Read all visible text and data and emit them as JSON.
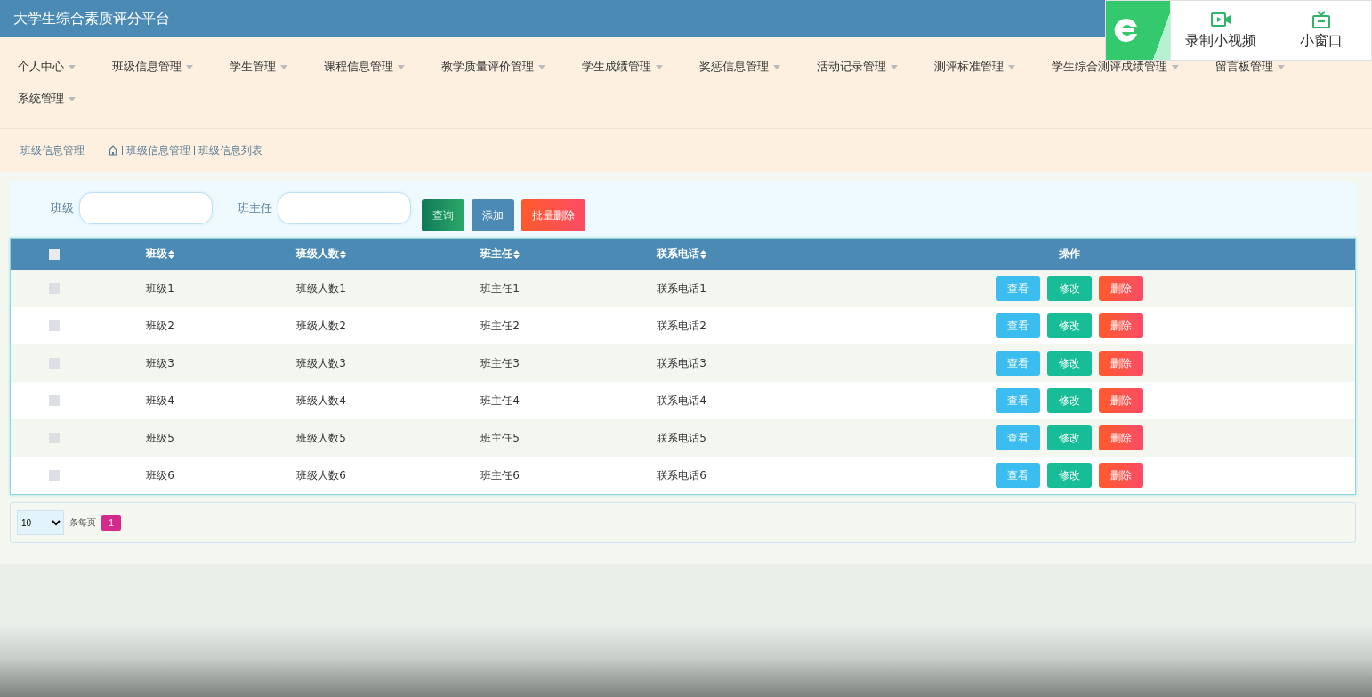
{
  "app_title": "大学生综合素质评分平台",
  "nav": {
    "items": [
      {
        "label": "个人中心"
      },
      {
        "label": "班级信息管理"
      },
      {
        "label": "学生管理"
      },
      {
        "label": "课程信息管理"
      },
      {
        "label": "教学质量评价管理"
      },
      {
        "label": "学生成绩管理"
      },
      {
        "label": "奖惩信息管理"
      },
      {
        "label": "活动记录管理"
      },
      {
        "label": "测评标准管理"
      },
      {
        "label": "学生综合测评成绩管理"
      },
      {
        "label": "留言板管理"
      },
      {
        "label": "系统管理"
      }
    ]
  },
  "breadcrumb": {
    "section": "班级信息管理",
    "path": [
      "班级信息管理",
      "班级信息列表"
    ]
  },
  "search": {
    "fields": [
      {
        "label": "班级"
      },
      {
        "label": "班主任"
      }
    ],
    "buttons": [
      {
        "label": "查询",
        "kind": "search"
      },
      {
        "label": "添加",
        "kind": "add"
      },
      {
        "label": "批量删除",
        "kind": "danger"
      }
    ]
  },
  "table": {
    "header_checked": false,
    "columns": [
      {
        "label": "班级",
        "sortable": true
      },
      {
        "label": "班级人数",
        "sortable": true
      },
      {
        "label": "班主任",
        "sortable": true
      },
      {
        "label": "联系电话",
        "sortable": true
      },
      {
        "label": "操作",
        "sortable": false
      }
    ],
    "rows": [
      {
        "checked": false,
        "cells": [
          "班级1",
          "班级人数1",
          "班主任1",
          "联系电话1"
        ],
        "actions": [
          {
            "label": "查看",
            "kind": "view"
          },
          {
            "label": "修改",
            "kind": "edit"
          },
          {
            "label": "删除",
            "kind": "delete"
          }
        ]
      },
      {
        "checked": false,
        "cells": [
          "班级2",
          "班级人数2",
          "班主任2",
          "联系电话2"
        ],
        "actions": [
          {
            "label": "查看",
            "kind": "view"
          },
          {
            "label": "修改",
            "kind": "edit"
          },
          {
            "label": "删除",
            "kind": "delete"
          }
        ]
      },
      {
        "checked": false,
        "cells": [
          "班级3",
          "班级人数3",
          "班主任3",
          "联系电话3"
        ],
        "actions": [
          {
            "label": "查看",
            "kind": "view"
          },
          {
            "label": "修改",
            "kind": "edit"
          },
          {
            "label": "删除",
            "kind": "delete"
          }
        ]
      },
      {
        "checked": false,
        "cells": [
          "班级4",
          "班级人数4",
          "班主任4",
          "联系电话4"
        ],
        "actions": [
          {
            "label": "查看",
            "kind": "view"
          },
          {
            "label": "修改",
            "kind": "edit"
          },
          {
            "label": "删除",
            "kind": "delete"
          }
        ]
      },
      {
        "checked": false,
        "cells": [
          "班级5",
          "班级人数5",
          "班主任5",
          "联系电话5"
        ],
        "actions": [
          {
            "label": "查看",
            "kind": "view"
          },
          {
            "label": "修改",
            "kind": "edit"
          },
          {
            "label": "删除",
            "kind": "delete"
          }
        ]
      },
      {
        "checked": false,
        "cells": [
          "班级6",
          "班级人数6",
          "班主任6",
          "联系电话6"
        ],
        "actions": [
          {
            "label": "查看",
            "kind": "view"
          },
          {
            "label": "修改",
            "kind": "edit"
          },
          {
            "label": "删除",
            "kind": "delete"
          }
        ]
      }
    ]
  },
  "pagination": {
    "page_size": "10",
    "per_page_label": "条每页",
    "pages": [
      {
        "label": "1",
        "selected": true
      }
    ]
  },
  "overlay": {
    "buttons": [
      {
        "label": "录制小视频",
        "kind": "record"
      },
      {
        "label": "小窗口",
        "kind": "window"
      }
    ]
  }
}
